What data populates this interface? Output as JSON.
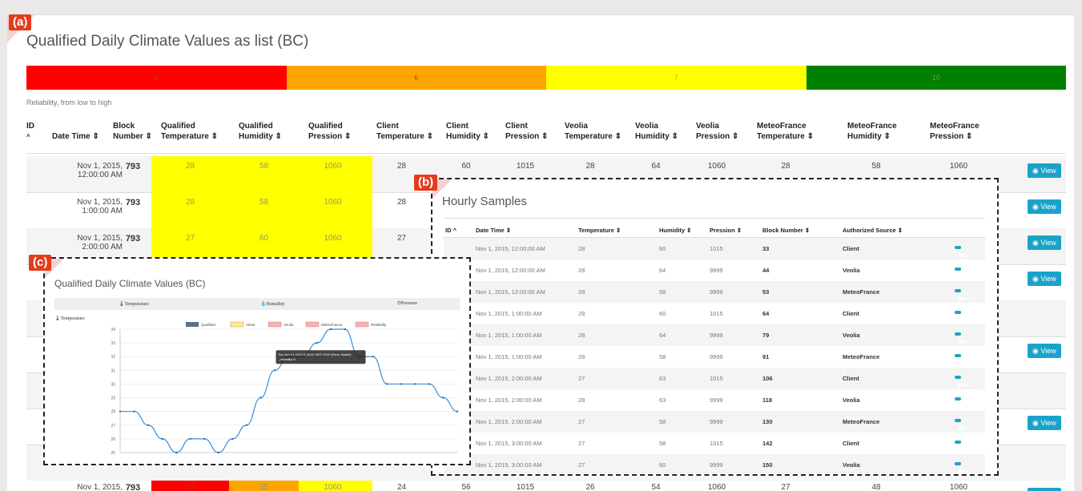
{
  "panel_a": {
    "tag": "(a)",
    "title": "Qualified Daily Climate Values as list (BC)",
    "legend": [
      {
        "label": "4",
        "color": "#ff0000"
      },
      {
        "label": "6",
        "color": "#ffa500"
      },
      {
        "label": "7",
        "color": "#ffff00"
      },
      {
        "label": "10",
        "color": "#008000"
      }
    ],
    "reliability_note": "Reliability, from low to high",
    "headers": [
      {
        "l1": "ID",
        "l2": "^"
      },
      {
        "l1": "",
        "l2": "Date Time ⇕"
      },
      {
        "l1": "Block",
        "l2": "Number ⇕"
      },
      {
        "l1": "Qualified",
        "l2": "Temperature ⇕"
      },
      {
        "l1": "Qualified",
        "l2": "Humidity ⇕"
      },
      {
        "l1": "Qualified",
        "l2": "Pression ⇕"
      },
      {
        "l1": "Client",
        "l2": "Temperature ⇕"
      },
      {
        "l1": "Client",
        "l2": "Humidity ⇕"
      },
      {
        "l1": "Client",
        "l2": "Pression ⇕"
      },
      {
        "l1": "Veolia",
        "l2": "Temperature ⇕"
      },
      {
        "l1": "Veolia",
        "l2": "Humidity ⇕"
      },
      {
        "l1": "Veolia",
        "l2": "Pression ⇕"
      },
      {
        "l1": "MeteoFrance",
        "l2": "Temperature ⇕"
      },
      {
        "l1": "MeteoFrance",
        "l2": "Humidity ⇕"
      },
      {
        "l1": "MeteoFrance",
        "l2": "Pression ⇕"
      }
    ],
    "rows": [
      {
        "date1": "Nov 1, 2015,",
        "date2": "12:00:00 AM",
        "block": "793",
        "qt": "28",
        "qh": "58",
        "qp": "1060",
        "ct": "28",
        "ch": "60",
        "cp": "1015",
        "vt": "28",
        "vh": "64",
        "vp": "1060",
        "mt": "28",
        "mh": "58",
        "mp": "1060"
      },
      {
        "date1": "Nov 1, 2015,",
        "date2": "1:00:00 AM",
        "block": "793",
        "qt": "28",
        "qh": "58",
        "qp": "1060",
        "ct": "28"
      },
      {
        "date1": "Nov 1, 2015,",
        "date2": "2:00:00 AM",
        "block": "793",
        "qt": "27",
        "qh": "60",
        "qp": "1060",
        "ct": "27"
      },
      {
        "date1": "Nov 1, 2015,",
        "block": "793",
        "qt": "27",
        "qh": "55",
        "qp": "1060",
        "ct": "24",
        "ch": "56",
        "cp": "1015",
        "vt": "26",
        "vh": "54",
        "vp": "1060",
        "mt": "27",
        "mh": "48",
        "mp": "1060"
      }
    ],
    "view_label": "View",
    "eye_icon": "eye-icon"
  },
  "panel_b": {
    "tag": "(b)",
    "title": "Hourly Samples",
    "headers": [
      "ID ^",
      "Date Time ⇕",
      "Temperature ⇕",
      "Humidity ⇕",
      "Pression ⇕",
      "Block Number ⇕",
      "Authorized Source ⇕"
    ],
    "rows": [
      {
        "date": "Nov 1, 2015, 12:00:00 AM",
        "temp": "28",
        "hum": "60",
        "pres": "1015",
        "block": "33",
        "source": "Client"
      },
      {
        "date": "Nov 1, 2015, 12:00:00 AM",
        "temp": "28",
        "hum": "64",
        "pres": "9999",
        "block": "44",
        "source": "Veolia"
      },
      {
        "date": "Nov 1, 2015, 12:00:00 AM",
        "temp": "28",
        "hum": "58",
        "pres": "9999",
        "block": "53",
        "source": "MeteoFrance"
      },
      {
        "date": "Nov 1, 2015, 1:00:00 AM",
        "temp": "28",
        "hum": "60",
        "pres": "1015",
        "block": "64",
        "source": "Client"
      },
      {
        "date": "Nov 1, 2015, 1:00:00 AM",
        "temp": "28",
        "hum": "64",
        "pres": "9999",
        "block": "79",
        "source": "Veolia"
      },
      {
        "date": "Nov 1, 2015, 1:00:00 AM",
        "temp": "28",
        "hum": "58",
        "pres": "9999",
        "block": "91",
        "source": "MeteoFrance"
      },
      {
        "date": "Nov 1, 2015, 2:00:00 AM",
        "temp": "27",
        "hum": "63",
        "pres": "1015",
        "block": "106",
        "source": "Client"
      },
      {
        "date": "Nov 1, 2015, 2:00:00 AM",
        "temp": "28",
        "hum": "63",
        "pres": "9999",
        "block": "118",
        "source": "Veolia"
      },
      {
        "date": "Nov 1, 2015, 2:00:00 AM",
        "temp": "27",
        "hum": "58",
        "pres": "9999",
        "block": "130",
        "source": "MeteoFrance"
      },
      {
        "date": "Nov 1, 2015, 3:00:00 AM",
        "temp": "27",
        "hum": "58",
        "pres": "1015",
        "block": "142",
        "source": "Client"
      },
      {
        "date": "Nov 1, 2015, 3:00:00 AM",
        "temp": "27",
        "hum": "60",
        "pres": "9999",
        "block": "150",
        "source": "Veolia"
      }
    ]
  },
  "panel_c": {
    "tag": "(c)",
    "title": "Qualified Daily Climate Values (BC)",
    "tabs": [
      "🌡Temperature",
      "💧Humidity",
      "⏲Pressure"
    ],
    "section_label": "🌡Temperature"
  },
  "chart_data": {
    "type": "line",
    "legend": [
      "Qualified",
      "Client",
      "Veolia",
      "MeteoFrance",
      "Reliability"
    ],
    "legend_colors": [
      "#5a6f86",
      "#f5f08a",
      "#f3b3b3",
      "#f3b3b3",
      "#f3b3b3"
    ],
    "line_color": "#3a8fd9",
    "yticks": [
      25,
      26,
      27,
      28,
      29,
      30,
      31,
      32,
      33,
      34
    ],
    "ylim": [
      25,
      34
    ],
    "values": [
      28,
      28,
      27,
      26,
      25,
      26,
      26,
      25,
      26,
      27,
      29,
      31,
      32,
      32,
      33,
      34,
      34,
      32,
      32,
      30,
      30,
      30,
      30,
      29,
      28
    ],
    "tooltip": [
      "Sun Nov 01 2015 11:00:00 GMT+0100 (Paris, Madrid)",
      "_reliability=4"
    ],
    "tooltip_index": 12
  }
}
